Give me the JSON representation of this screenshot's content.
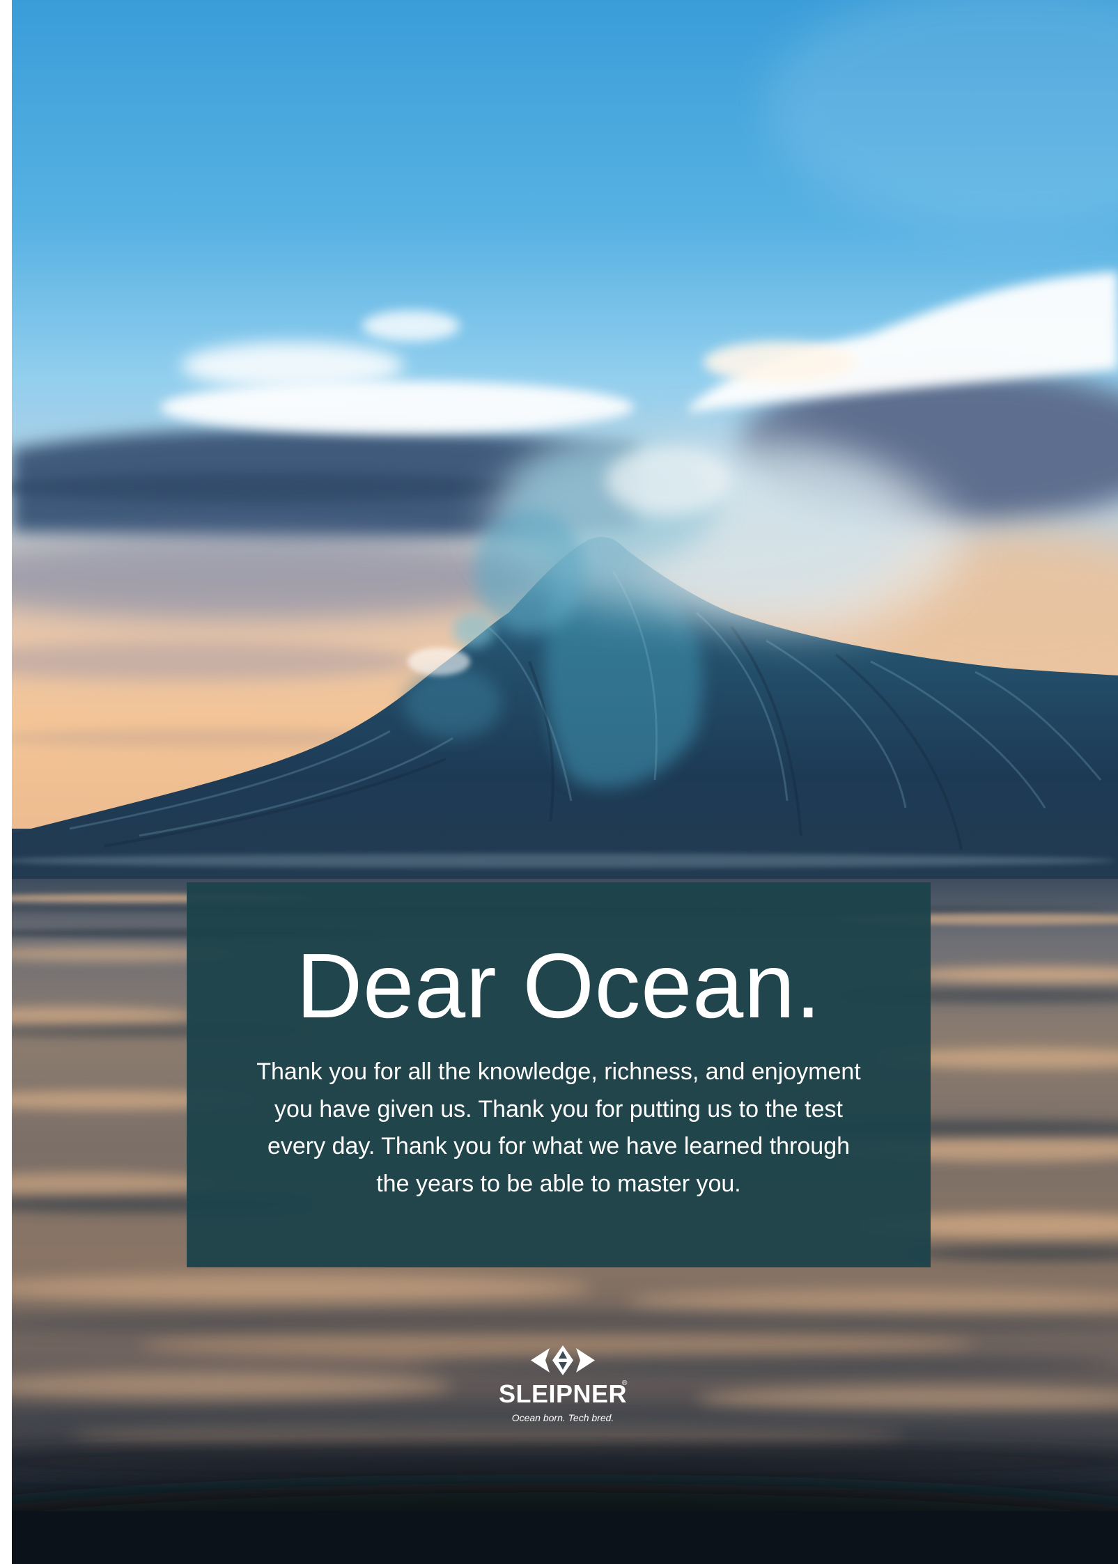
{
  "card": {
    "title": "Dear Ocean.",
    "body_lines": [
      "Thank you for all the knowledge, richness, and enjoyment",
      "you have given us. Thank you for putting us to the test",
      "every day. Thank you for what we have learned through",
      "the years to be able to master you."
    ],
    "background": "#1b424a",
    "text_color": "#ffffff"
  },
  "logo": {
    "icon": "sleipner-logo-icon",
    "brand": "SLEIPNER",
    "registered_mark": "®",
    "tagline": "Ocean born. Tech bred.",
    "color": "#ffffff"
  },
  "colors": {
    "sky": "#3a9dd8",
    "horizon_glow": "#f3c496",
    "wave": "#1d3a55",
    "wave_highlight": "#3e8fab",
    "spray": "#e8eef0",
    "sea_dark": "#0e151d"
  }
}
